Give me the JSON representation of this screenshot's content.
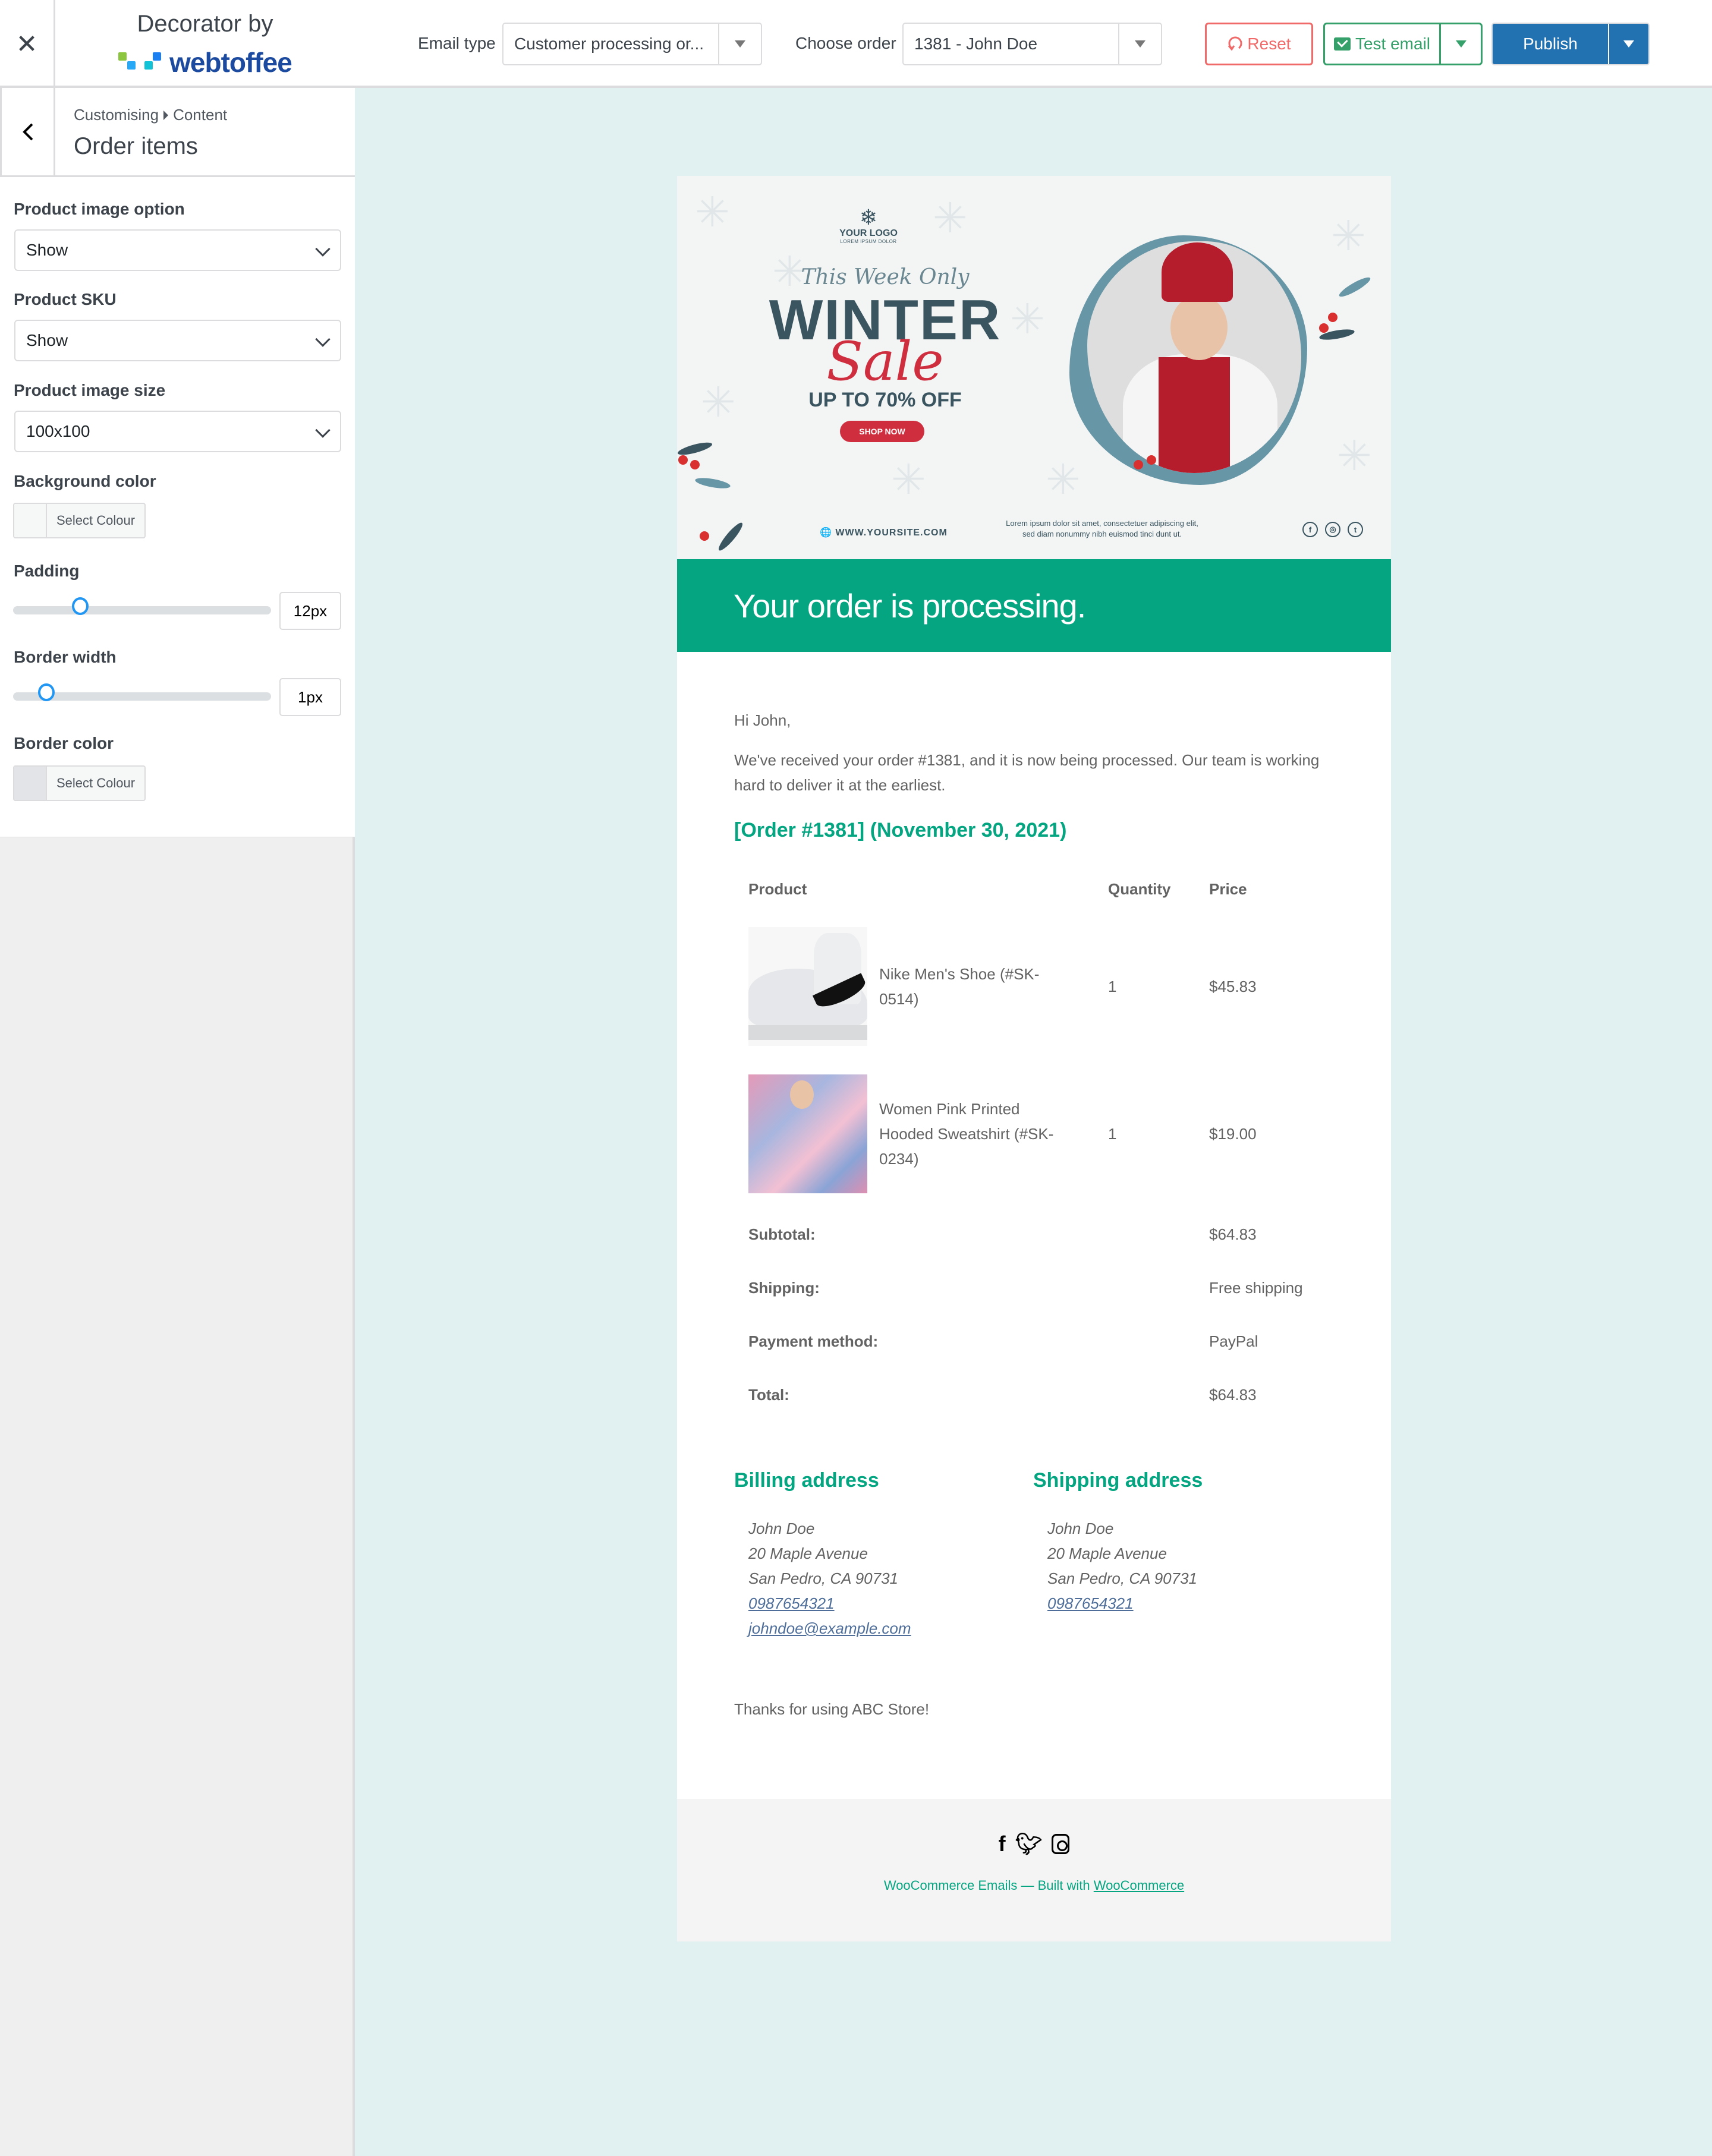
{
  "brand": {
    "title": "Decorator by",
    "logo_text": "webtoffee"
  },
  "section": {
    "breadcrumb_parent": "Customising",
    "breadcrumb_child": "Content",
    "title": "Order items"
  },
  "controls": {
    "product_image_option": {
      "label": "Product image option",
      "value": "Show"
    },
    "product_sku": {
      "label": "Product SKU",
      "value": "Show"
    },
    "product_image_size": {
      "label": "Product image size",
      "value": "100x100"
    },
    "background_color": {
      "label": "Background color",
      "button": "Select Colour",
      "swatch": "#f6f7f7"
    },
    "padding": {
      "label": "Padding",
      "value": "12px",
      "slider_fraction": 0.26
    },
    "border_width": {
      "label": "Border width",
      "value": "1px",
      "slider_fraction": 0.13
    },
    "border_color": {
      "label": "Border color",
      "button": "Select Colour",
      "swatch": "#e2e4e7"
    }
  },
  "toolbar": {
    "email_type_label": "Email type",
    "email_type_value": "Customer processing or...",
    "choose_order_label": "Choose order",
    "choose_order_value": "1381 - John Doe",
    "reset": "Reset",
    "test_email": "Test email",
    "publish": "Publish"
  },
  "banner": {
    "logo_title": "YOUR LOGO",
    "logo_sub": "LOREM IPSUM DOLOR",
    "tagline": "This Week Only",
    "headline": "WINTER",
    "sale": "Sale",
    "offer": "UP TO 70% OFF",
    "cta": "SHOP NOW",
    "website": "WWW.YOURSITE.COM",
    "lorem": "Lorem ipsum dolor sit amet, consectetuer adipiscing elit, sed diam nonummy nibh euismod tinci dunt ut.",
    "social": [
      "f",
      "◎",
      "t"
    ]
  },
  "email": {
    "heading": "Your order is processing.",
    "greeting": "Hi John,",
    "intro": "We've received your order #1381, and it is now being processed. Our team is working hard to deliver it at the earliest.",
    "order_title": "[Order #1381] (November 30, 2021)",
    "table": {
      "headers": [
        "Product",
        "Quantity",
        "Price"
      ],
      "rows": [
        {
          "product": "Nike Men's Shoe (#SK-0514)",
          "quantity": "1",
          "price": "$45.83"
        },
        {
          "product": "Women Pink Printed Hooded Sweatshirt (#SK-0234)",
          "quantity": "1",
          "price": "$19.00"
        }
      ],
      "totals": [
        {
          "label": "Subtotal:",
          "value": "$64.83"
        },
        {
          "label": "Shipping:",
          "value": "Free shipping"
        },
        {
          "label": "Payment method:",
          "value": "PayPal"
        },
        {
          "label": "Total:",
          "value": "$64.83"
        }
      ]
    },
    "billing": {
      "title": "Billing address",
      "name": "John Doe",
      "street": "20 Maple Avenue",
      "city": "San Pedro, CA 90731",
      "phone": "0987654321",
      "email": "johndoe@example.com"
    },
    "shipping": {
      "title": "Shipping address",
      "name": "John Doe",
      "street": "20 Maple Avenue",
      "city": "San Pedro, CA 90731",
      "phone": "0987654321"
    },
    "thanks": "Thanks for using ABC Store!",
    "footer_text": "WooCommerce Emails — Built with ",
    "footer_link": "WooCommerce"
  },
  "colors": {
    "accent_green": "#05a582",
    "publish_blue": "#2271b1",
    "reset_red": "#f06a6a",
    "test_green": "#35a06a",
    "preview_bg": "#e1f0f0"
  }
}
